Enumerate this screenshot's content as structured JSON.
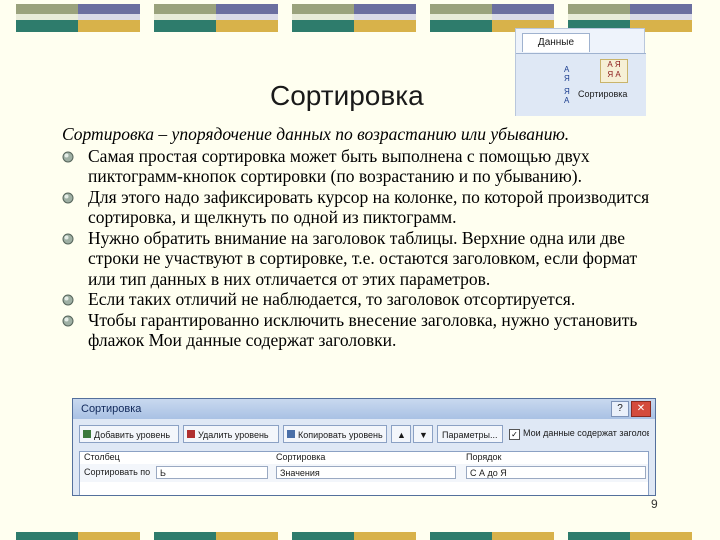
{
  "slide": {
    "title": "Сортировка",
    "page_number": "9"
  },
  "ribbon": {
    "tab_label": "Данные",
    "sort_az_glyph": "А\nЯ",
    "sort_za_glyph": "Я\nА",
    "big_sort_glyph": "А Я\nЯ А",
    "sort_button_label": "Сортировка"
  },
  "content": {
    "lead_term": "Сортировка",
    "lead_rest": " – упорядочение данных по возрастанию или убыванию.",
    "items": [
      " Самая простая сортировка может быть выполнена с помощью двух пиктограмм-кнопок сортировки (по возрастанию и по убыванию).",
      " Для этого надо зафиксировать курсор на колонке, по которой производится сортировка, и щелкнуть по одной из пиктограмм.",
      " Нужно обратить внимание на заголовок таблицы. Верхние одна или  две строки не участвуют в сортировке, т.е. остаются заголовком, если формат или тип данных в них отличается от этих параметров.",
      "Если таких отличий не наблюдается, то заголовок отсортируется.",
      "Чтобы гарантированно исключить внесение заголовка, нужно установить флажок Мои данные содержат заголовки."
    ]
  },
  "dialog": {
    "title": "Сортировка",
    "help_label": "?",
    "close_label": "✕",
    "toolbar": {
      "add_level": "Добавить уровень",
      "delete_level": "Удалить уровень",
      "copy_level": "Копировать уровень",
      "move_up": "▲",
      "move_down": "▼",
      "parameters": "Параметры...",
      "header_checkbox_mark": "✓",
      "header_checkbox_label": "Мои данные содержат заголовки"
    },
    "columns": {
      "column": "Столбец",
      "sort": "Сортировка",
      "order": "Порядок"
    },
    "row": {
      "label": "Сортировать по",
      "column_value": "Ь",
      "sort_value": "Значения",
      "order_value": "С  А до Я"
    }
  },
  "colors": {
    "background": "#fffff0",
    "band_olive": "#9aa27c",
    "band_purple": "#6b6fa0",
    "band_teal": "#2e7c6c",
    "band_gold": "#d8b24a"
  }
}
